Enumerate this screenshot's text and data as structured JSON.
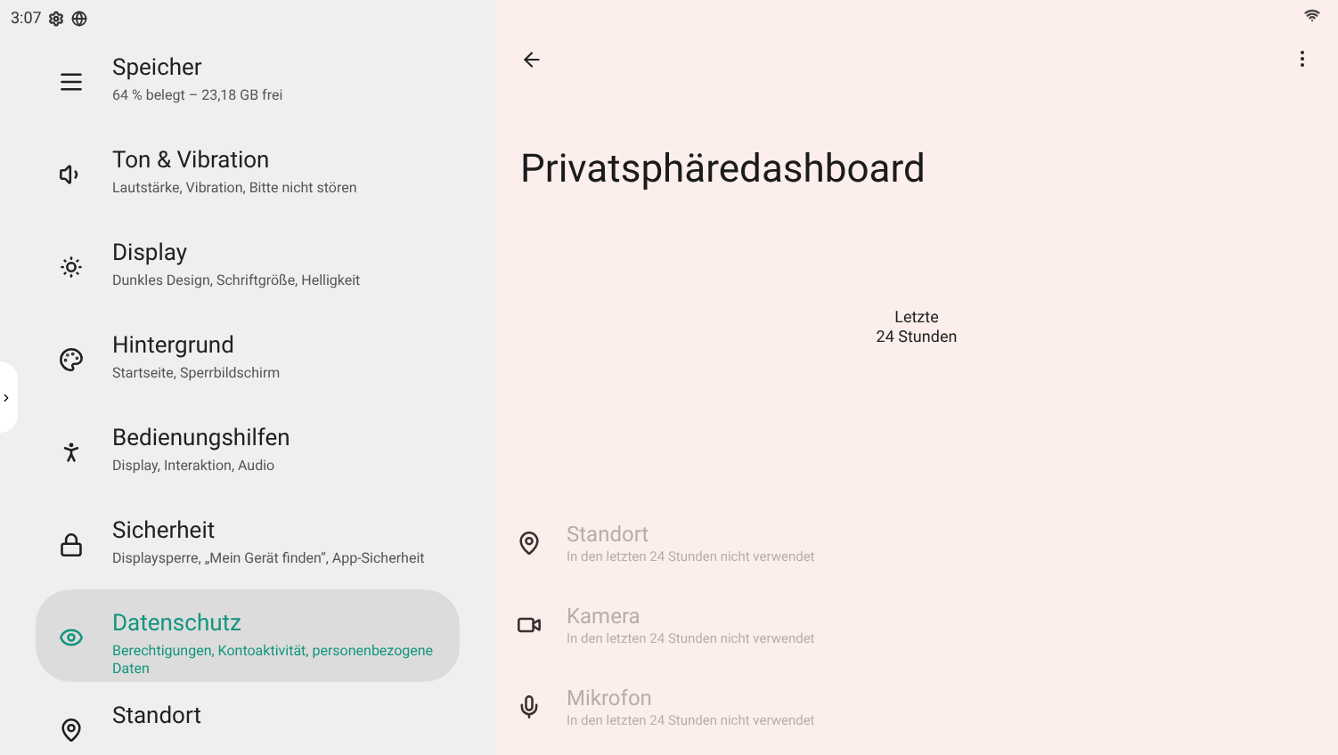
{
  "status_bar": {
    "time": "3:07"
  },
  "sidebar": {
    "items": [
      {
        "kind": "storage",
        "title": "Speicher",
        "subtitle": "64 % belegt – 23,18 GB frei",
        "selected": false
      },
      {
        "kind": "sound",
        "title": "Ton & Vibration",
        "subtitle": "Lautstärke, Vibration, Bitte nicht stören",
        "selected": false
      },
      {
        "kind": "display",
        "title": "Display",
        "subtitle": "Dunkles Design, Schriftgröße, Helligkeit",
        "selected": false
      },
      {
        "kind": "wallpaper",
        "title": "Hintergrund",
        "subtitle": "Startseite, Sperrbildschirm",
        "selected": false
      },
      {
        "kind": "accessibility",
        "title": "Bedienungshilfen",
        "subtitle": "Display, Interaktion, Audio",
        "selected": false
      },
      {
        "kind": "security",
        "title": "Sicherheit",
        "subtitle": "Displaysperre, „Mein Gerät finden“, App-Sicherheit",
        "selected": false
      },
      {
        "kind": "privacy",
        "title": "Datenschutz",
        "subtitle": "Berechtigungen, Kontoaktivität, personenbezogene Daten",
        "selected": true
      },
      {
        "kind": "location",
        "title": "Standort",
        "selected": false
      }
    ]
  },
  "page": {
    "title": "Privatsphäredashboard",
    "period": "Letzte\n24 Stunden",
    "usage": [
      {
        "kind": "location",
        "title": "Standort",
        "subtitle": "In den letzten 24 Stunden nicht verwendet",
        "disabled": true
      },
      {
        "kind": "camera",
        "title": "Kamera",
        "subtitle": "In den letzten 24 Stunden nicht verwendet",
        "disabled": true
      },
      {
        "kind": "mic",
        "title": "Mikrofon",
        "subtitle": "In den letzten 24 Stunden nicht verwendet",
        "disabled": true
      }
    ]
  }
}
